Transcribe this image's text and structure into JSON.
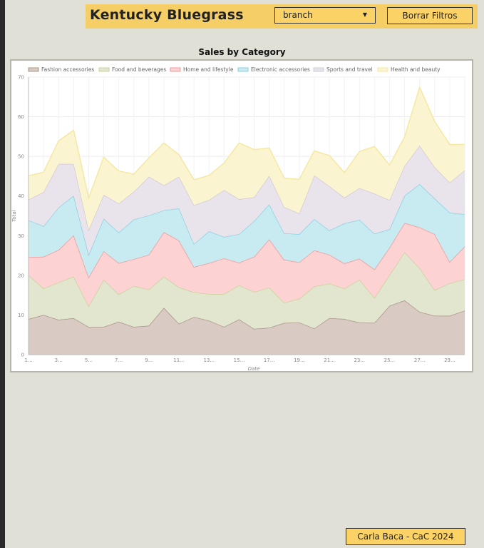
{
  "header": {
    "brand": "Kentucky Bluegrass",
    "select_value": "branch",
    "clear_button": "Borrar Filtros"
  },
  "footer": {
    "credit": "Carla Baca - CaC 2024"
  },
  "chart_data": {
    "type": "area",
    "stacked": true,
    "title": "Sales by Category",
    "xlabel": "Date",
    "ylabel": "Total",
    "ylim": [
      0,
      70
    ],
    "yticks": [
      0,
      10,
      20,
      30,
      40,
      50,
      60,
      70
    ],
    "grid": true,
    "legend_position": "top-left",
    "x": [
      1,
      2,
      3,
      4,
      5,
      6,
      7,
      8,
      9,
      10,
      11,
      12,
      13,
      14,
      15,
      16,
      17,
      18,
      19,
      20,
      21,
      22,
      23,
      24,
      25,
      26,
      27,
      28,
      29,
      30
    ],
    "xtick_labels": [
      "1...",
      "3...",
      "5...",
      "7...",
      "9...",
      "11...",
      "13...",
      "15...",
      "17...",
      "19...",
      "21...",
      "23...",
      "25...",
      "27...",
      "29..."
    ],
    "series": [
      {
        "name": "Fashion accessories",
        "color": "#a89488",
        "fill": "#d9cbc4",
        "values": [
          9.0,
          10.0,
          8.8,
          9.2,
          7.0,
          7.0,
          8.3,
          7.0,
          7.3,
          11.8,
          7.8,
          9.5,
          8.6,
          7.0,
          8.9,
          6.5,
          6.8,
          8.0,
          8.1,
          6.6,
          9.2,
          9.0,
          8.1,
          8.0,
          12.3,
          13.7,
          10.8,
          9.8,
          9.8,
          11.1
        ]
      },
      {
        "name": "Food and beverages",
        "color": "#c9d29a",
        "fill": "#e3e6cf",
        "values": [
          11.1,
          6.7,
          9.4,
          10.5,
          5.2,
          11.9,
          6.9,
          10.3,
          9.1,
          7.9,
          9.2,
          6.2,
          6.7,
          8.3,
          8.6,
          9.3,
          10.1,
          5.1,
          6.0,
          10.6,
          8.7,
          7.7,
          10.8,
          6.3,
          7.8,
          12.1,
          11.0,
          6.5,
          8.2,
          7.9
        ]
      },
      {
        "name": "Home and lifestyle",
        "color": "#f09898",
        "fill": "#fcd2d2",
        "values": [
          4.5,
          8.0,
          8.2,
          10.4,
          7.3,
          7.2,
          7.9,
          6.8,
          8.8,
          11.2,
          11.8,
          6.4,
          7.8,
          9.0,
          5.7,
          8.9,
          12.2,
          10.8,
          9.2,
          9.1,
          7.3,
          6.3,
          5.3,
          7.2,
          6.9,
          7.4,
          10.3,
          14.1,
          5.4,
          8.3
        ]
      },
      {
        "name": "Electronic accessories",
        "color": "#8ccfe0",
        "fill": "#c8ebf2",
        "values": [
          9.3,
          7.7,
          10.7,
          10.0,
          5.7,
          8.2,
          7.7,
          10.0,
          9.9,
          5.5,
          8.1,
          5.8,
          8.0,
          5.4,
          7.2,
          9.0,
          8.8,
          6.7,
          7.1,
          7.9,
          6.1,
          10.1,
          9.8,
          9.0,
          4.6,
          6.9,
          10.9,
          9.0,
          12.4,
          8.1
        ]
      },
      {
        "name": "Sports and travel",
        "color": "#d2c9d7",
        "fill": "#e9e4ec",
        "values": [
          5.2,
          8.6,
          11.0,
          8.0,
          6.3,
          6.0,
          7.3,
          7.0,
          9.8,
          6.3,
          8.0,
          9.8,
          7.9,
          11.8,
          8.8,
          6.0,
          7.2,
          6.6,
          5.2,
          11.0,
          11.2,
          6.5,
          8.0,
          10.1,
          7.4,
          7.5,
          9.7,
          7.9,
          7.6,
          11.1
        ]
      },
      {
        "name": "Health and beauty",
        "color": "#f5e8a0",
        "fill": "#fbf4d1",
        "values": [
          6.0,
          5.0,
          5.8,
          8.5,
          8.0,
          9.5,
          8.2,
          4.4,
          4.7,
          10.7,
          5.5,
          6.4,
          6.2,
          6.8,
          14.2,
          12.0,
          7.0,
          7.3,
          8.6,
          6.2,
          7.7,
          6.3,
          9.2,
          11.9,
          8.8,
          7.3,
          14.7,
          11.5,
          9.6,
          6.5
        ]
      }
    ]
  }
}
